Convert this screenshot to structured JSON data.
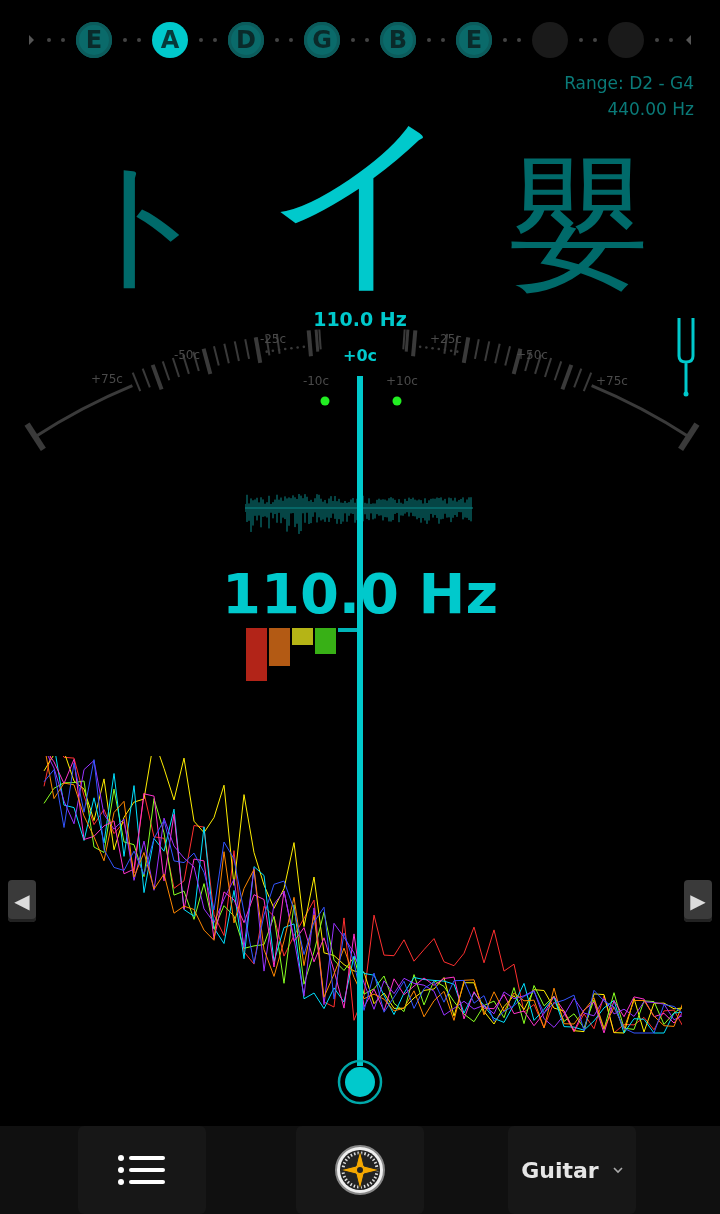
{
  "strings": [
    {
      "kind": "note",
      "label": "E",
      "selected": false
    },
    {
      "kind": "note",
      "label": "A",
      "selected": true
    },
    {
      "kind": "note",
      "label": "D",
      "selected": false
    },
    {
      "kind": "note",
      "label": "G",
      "selected": false
    },
    {
      "kind": "note",
      "label": "B",
      "selected": false
    },
    {
      "kind": "note",
      "label": "E",
      "selected": false
    },
    {
      "kind": "empty"
    },
    {
      "kind": "empty"
    }
  ],
  "range": "Range: D2 - G4",
  "reference": "440.00 Hz",
  "notes": [
    {
      "label": "ト",
      "selected": false
    },
    {
      "label": "イ",
      "selected": true
    },
    {
      "label": "嬰",
      "selected": false
    }
  ],
  "dial": {
    "frequency": "110.0 Hz",
    "cents": "+0c",
    "labels": [
      "+75c",
      "-50c",
      "-25c",
      "-10c",
      "+10c",
      "+25c",
      "+50c",
      "+75c"
    ]
  },
  "frequency": "110.0 Hz",
  "harmonics": [
    {
      "color": "#b22418"
    },
    {
      "color": "#b35a14"
    },
    {
      "color": "#b5b416"
    },
    {
      "color": "#38b016"
    },
    {
      "color": "#00b5b8"
    }
  ],
  "nav": {
    "prev": "◀",
    "next": "▶"
  },
  "toolbar": {
    "instrument": "Guitar"
  }
}
